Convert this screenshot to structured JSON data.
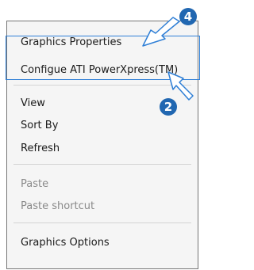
{
  "context_menu": {
    "group_top": [
      {
        "label": "Graphics Properties",
        "enabled": true
      },
      {
        "label": "Configue ATI PowerXpress(TM)",
        "enabled": true
      }
    ],
    "group_view": [
      {
        "label": "View",
        "enabled": true
      },
      {
        "label": "Sort By",
        "enabled": true
      },
      {
        "label": "Refresh",
        "enabled": true
      }
    ],
    "group_paste": [
      {
        "label": "Paste",
        "enabled": false
      },
      {
        "label": "Paste shortcut",
        "enabled": false
      }
    ],
    "group_bottom": [
      {
        "label": "Graphics Options",
        "enabled": true
      }
    ]
  },
  "callouts": {
    "badge_top": "4",
    "badge_bottom": "2",
    "accent_color": "#2167b1",
    "highlight_color": "#2f7fd6"
  }
}
